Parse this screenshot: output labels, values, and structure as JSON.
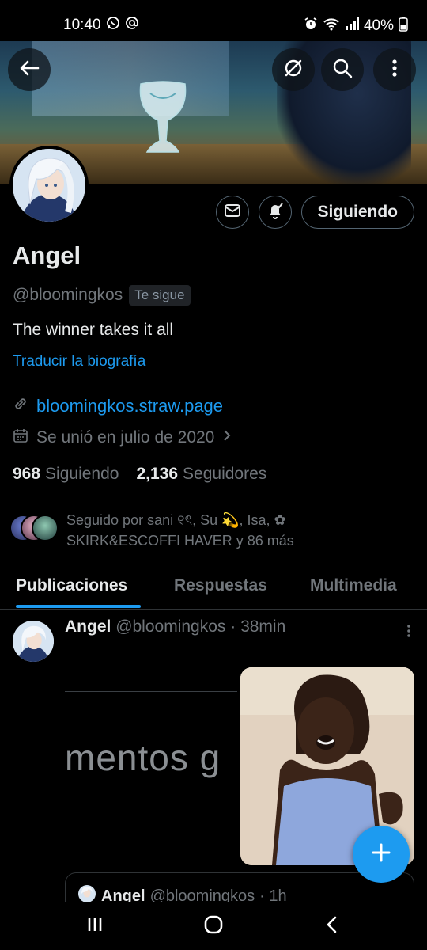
{
  "status_bar": {
    "time": "10:40",
    "battery": "40%",
    "icons": [
      "whatsapp-icon",
      "at-icon",
      "alarm-icon",
      "wifi-icon",
      "signal-icon",
      "battery-icon"
    ]
  },
  "header": {
    "back_icon": "arrow-left-icon",
    "grok_icon": "grok-icon",
    "search_icon": "search-icon",
    "more_icon": "more-vertical-icon"
  },
  "profile": {
    "name": "Angel",
    "handle": "@bloomingkos",
    "follows_you_badge": "Te sigue",
    "bio": "The winner takes it all",
    "translate_bio": "Traducir la biografía",
    "website": "bloomingkos.straw.page",
    "joined": "Se unió en julio de 2020",
    "following_count": "968",
    "following_label": "Siguiendo",
    "followers_count": "2,136",
    "followers_label": "Seguidores",
    "followed_by": "Seguido por sani ୧ৎ, Su 💫, Isa, ✿ SKIRK&ESCOFFI HAVER y 86 más"
  },
  "actions": {
    "message_icon": "mail-icon",
    "notify_icon": "bell-check-icon",
    "follow_button": "Siguiendo"
  },
  "tabs": [
    {
      "label": "Publicaciones",
      "active": true
    },
    {
      "label": "Respuestas",
      "active": false
    },
    {
      "label": "Multimedia",
      "active": false
    }
  ],
  "post": {
    "author": "Angel",
    "handle": "@bloomingkos",
    "time": "· 38min",
    "text_preview": "mentos g",
    "quote": {
      "author": "Angel",
      "handle": "@bloomingkos",
      "time": "· 1h"
    }
  },
  "colors": {
    "accent": "#1d9bf0",
    "background": "#000000",
    "text_primary": "#e7e9ea",
    "text_secondary": "#71767b"
  }
}
